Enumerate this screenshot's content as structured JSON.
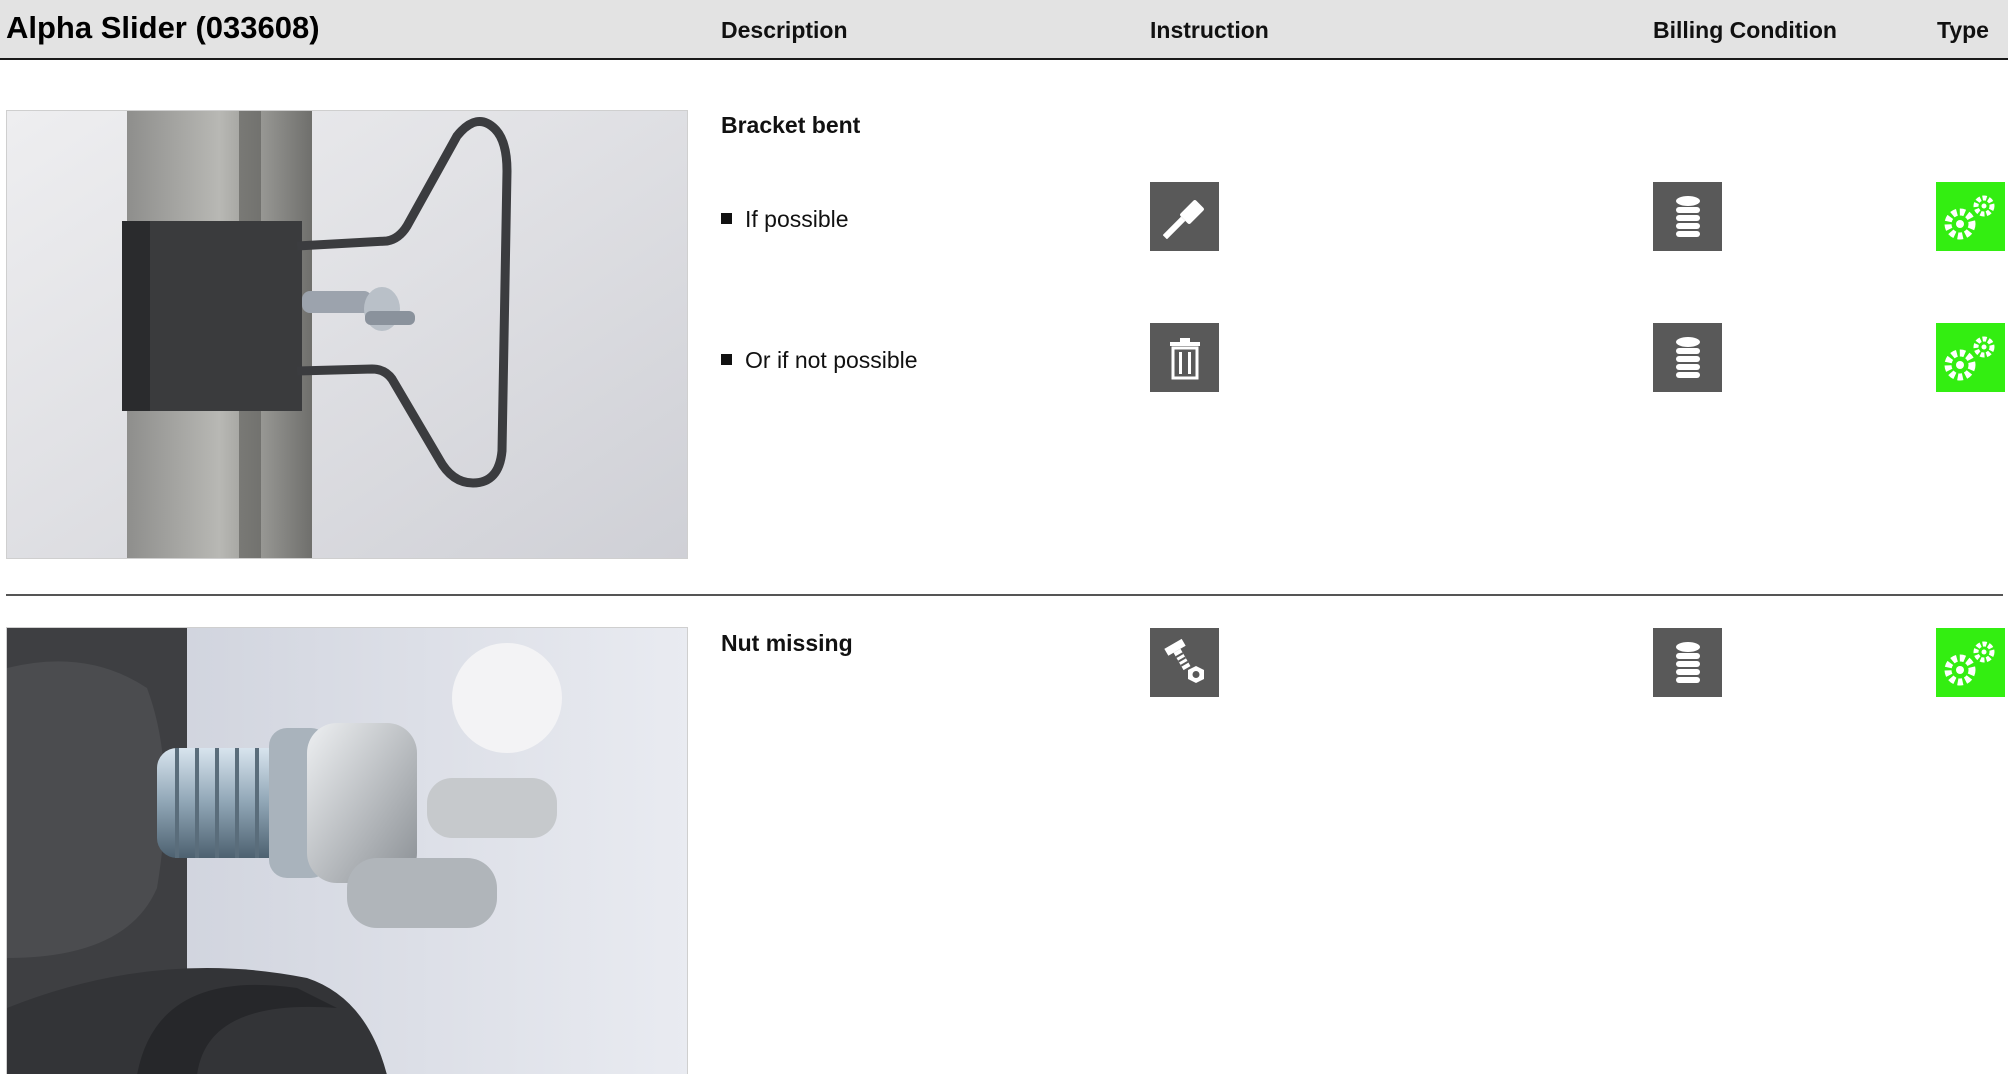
{
  "header": {
    "title": "Alpha Slider (033608)",
    "columns": {
      "description": "Description",
      "instruction": "Instruction",
      "billing": "Billing Condition",
      "type": "Type"
    }
  },
  "sections": [
    {
      "photo_icon": "bracket-photo",
      "heading": "Bracket bent",
      "rows": [
        {
          "label": "If possible",
          "instruction_icon": "hammer-icon",
          "billing_icon": "coins-icon",
          "type_icon": "gears-icon"
        },
        {
          "label": "Or if not possible",
          "instruction_icon": "trash-icon",
          "billing_icon": "coins-icon",
          "type_icon": "gears-icon"
        }
      ]
    },
    {
      "photo_icon": "wing-nut-photo",
      "heading": "Nut missing",
      "rows": [
        {
          "label": "",
          "instruction_icon": "bolt-nut-icon",
          "billing_icon": "coins-icon",
          "type_icon": "gears-icon"
        }
      ]
    }
  ],
  "colors": {
    "header_bg": "#e3e3e3",
    "icon_dark": "#595959",
    "icon_green": "#33ee11"
  }
}
